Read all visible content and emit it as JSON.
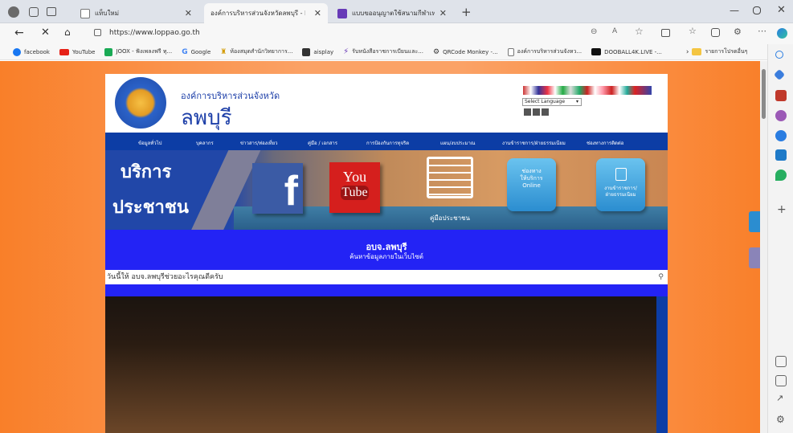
{
  "tabs": [
    {
      "label": "แท็บใหม่"
    },
    {
      "label": "องค์การบริหารส่วนจังหวัดลพบุรี - Hom"
    },
    {
      "label": "แบบขออนุญาตใช้สนามกีฬาเทศบาลฯ"
    }
  ],
  "address": {
    "url": "https://www.loppao.go.th"
  },
  "bookmarks": [
    {
      "label": "facebook"
    },
    {
      "label": "YouTube"
    },
    {
      "label": "JOOX - ฟังเพลงฟรี ทุ..."
    },
    {
      "label": "Google"
    },
    {
      "label": "ห้องสมุดสำนักวิทยาการ..."
    },
    {
      "label": "aisplay"
    },
    {
      "label": "รับหนังสือราชการเบียนและ..."
    },
    {
      "label": "QRCode Monkey -..."
    },
    {
      "label": "องค์การบริหารส่วนจังหว..."
    },
    {
      "label": "DOOBALL4K.LIVE -..."
    },
    {
      "label": "รายการโปรดอื่นๆ"
    }
  ],
  "site": {
    "org_line": "องค์การบริหารส่วนจังหวัด",
    "org_name": "ลพบุรี",
    "translate_label": "Select Language",
    "nav": [
      "ข้อมูลทั่วไป",
      "บุคลากร",
      "ข่าวสาร/ท่องเที่ยว",
      "คู่มือ / เอกสาร",
      "การป้องกันการทุจริต",
      "แผน/งบประมาณ",
      "งานข้าราชการ/ฝ่ายธรรมเนียม",
      "ช่องทางการติดต่อ"
    ],
    "banner": {
      "line1": "บริการ",
      "line2": "ประชาชน",
      "youtube1": "You",
      "youtube2": "Tube",
      "manual_label": "คู่มือประชาชน",
      "online_label1": "ช่องทาง",
      "online_label2": "ให้บริการ",
      "online_label3": "Online",
      "bureau_label1": "งานข้าราชการ/",
      "bureau_label2": "ฝ่ายธรรมเนียม"
    },
    "search_title": "อบจ.ลพบุรี",
    "search_sub": "ค้นหาข้อมูลภายในเว็บไซต์",
    "search_placeholder": "วันนี้ให้ อบจ.ลพบุรีช่วยอะไรคุณดีครับ"
  }
}
